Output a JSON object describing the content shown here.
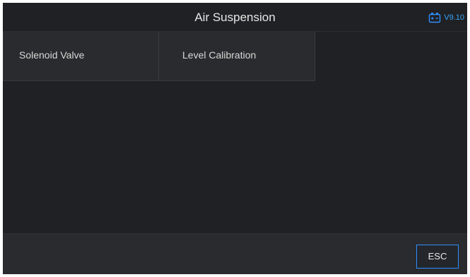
{
  "header": {
    "title": "Air Suspension",
    "battery_icon": "battery-icon",
    "version": "V9.10",
    "accent_color": "#2f8fff"
  },
  "menu": {
    "items": [
      {
        "label": "Solenoid Valve"
      },
      {
        "label": "Level Calibration"
      }
    ]
  },
  "footer": {
    "esc_label": "ESC"
  }
}
